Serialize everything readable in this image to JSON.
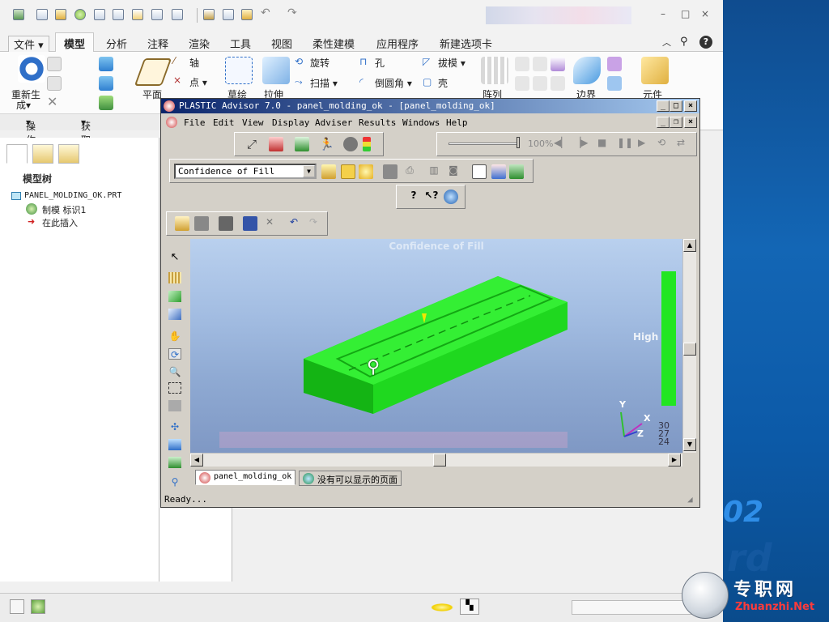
{
  "host": {
    "quick_access_icons": [
      "new-icon",
      "open-icon",
      "regenerate-icon",
      "save-icon",
      "copy-icon",
      "paste-icon",
      "window-icon",
      "dropdown-icon",
      "edit-icon",
      "check-icon",
      "folder-icon",
      "undo-icon",
      "redo-icon"
    ],
    "window_controls": [
      "–",
      "□",
      "×"
    ],
    "tabs": [
      {
        "label": "文件",
        "active": false
      },
      {
        "label": "模型",
        "active": true
      },
      {
        "label": "分析",
        "active": false
      },
      {
        "label": "注释",
        "active": false
      },
      {
        "label": "渲染",
        "active": false
      },
      {
        "label": "工具",
        "active": false
      },
      {
        "label": "视图",
        "active": false
      },
      {
        "label": "柔性建模",
        "active": false
      },
      {
        "label": "应用程序",
        "active": false
      },
      {
        "label": "新建选项卡",
        "active": false
      }
    ],
    "ribbon": {
      "regenerate": "重新生",
      "regenerate2": "成",
      "plane": "平面",
      "axis": "轴",
      "point": "点",
      "sketch": "草绘",
      "extrude": "拉伸",
      "revolve": "旋转",
      "sweep": "扫描",
      "hole": "孔",
      "round": "倒圆角",
      "draft": "拔模",
      "shell": "壳",
      "pattern": "阵列",
      "boundary": "边界",
      "component": "元件"
    },
    "groups": {
      "operations": "操作",
      "get_data": "获取数据"
    },
    "tree": {
      "heading": "模型树",
      "items": [
        "PANEL_MOLDING_OK.PRT",
        "制模 标识1",
        "在此插入"
      ]
    }
  },
  "advisor": {
    "title": "PLASTIC Advisor 7.0 - panel_molding_ok - [panel_molding_ok]",
    "menu": [
      "File",
      "Edit",
      "View",
      "Display",
      "Adviser",
      "Results",
      "Windows",
      "Help"
    ],
    "zoom_label": "100%",
    "result_select": "Confidence of Fill",
    "view_title": "Confidence of Fill",
    "legend_high": "High",
    "axes": {
      "y": "Y",
      "x": "X",
      "z": "Z"
    },
    "scale_numbers": [
      "30",
      "27",
      "24"
    ],
    "doc_tabs": [
      "panel_molding_ok",
      "没有可以显示的页面"
    ],
    "status": "Ready..."
  },
  "decor": {
    "year_fragment": "02",
    "site_cn": "专职网",
    "site_url": "Zhuanzhi.Net"
  },
  "colors": {
    "part_green": "#1fe01f",
    "legend_green": "#22e622",
    "titlebar": "#0a246a",
    "side_blue": "#1366b5"
  }
}
